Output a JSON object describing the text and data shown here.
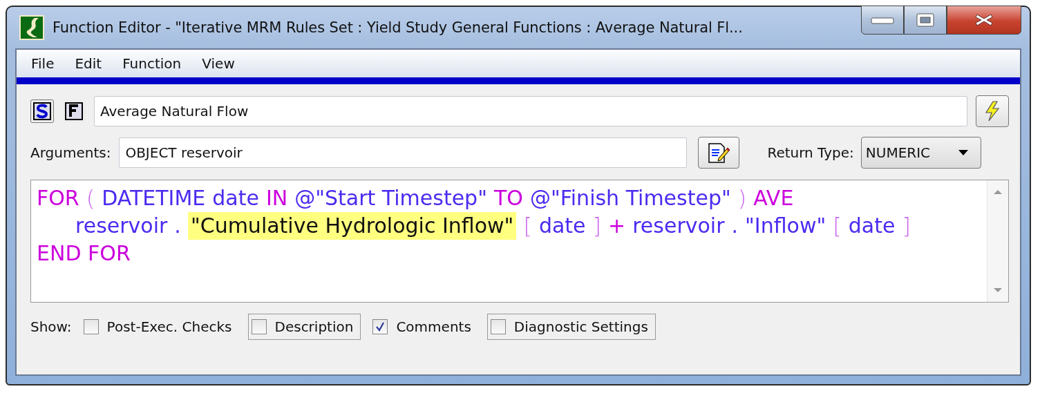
{
  "window": {
    "title": "Function Editor - \"Iterative MRM Rules Set : Yield Study General Functions : Average Natural Fl..."
  },
  "menu": [
    "File",
    "Edit",
    "Function",
    "View"
  ],
  "function_name": {
    "value": "Average Natural Flow"
  },
  "arguments": {
    "label": "Arguments:",
    "value": "OBJECT reservoir"
  },
  "return_type": {
    "label": "Return Type:",
    "value": "NUMERIC"
  },
  "code_lines": [
    {
      "indent": false,
      "tokens": [
        {
          "text": "FOR",
          "kind": "keyword"
        },
        {
          "text": "(",
          "kind": "bracket"
        },
        {
          "text": "DATETIME",
          "kind": "name"
        },
        {
          "text": "date",
          "kind": "name"
        },
        {
          "text": "IN",
          "kind": "keyword"
        },
        {
          "text": "@\"Start Timestep\"",
          "kind": "name"
        },
        {
          "text": "TO",
          "kind": "keyword"
        },
        {
          "text": "@\"Finish Timestep\"",
          "kind": "name"
        },
        {
          "text": ")",
          "kind": "bracket"
        },
        {
          "text": "AVE",
          "kind": "keyword"
        }
      ]
    },
    {
      "indent": true,
      "tokens": [
        {
          "text": "reservoir",
          "kind": "name"
        },
        {
          "text": ".",
          "kind": "name"
        },
        {
          "text": "\"Cumulative Hydrologic Inflow\"",
          "kind": "highlight"
        },
        {
          "text": "[",
          "kind": "bracket"
        },
        {
          "text": "date",
          "kind": "name"
        },
        {
          "text": "]",
          "kind": "bracket"
        },
        {
          "text": "+",
          "kind": "keyword"
        },
        {
          "text": "reservoir",
          "kind": "name"
        },
        {
          "text": ".",
          "kind": "name"
        },
        {
          "text": "\"Inflow\"",
          "kind": "name"
        },
        {
          "text": "[",
          "kind": "bracket"
        },
        {
          "text": "date",
          "kind": "name"
        },
        {
          "text": "]",
          "kind": "bracket"
        }
      ]
    },
    {
      "indent": false,
      "tokens": [
        {
          "text": "END FOR",
          "kind": "keyword"
        }
      ]
    }
  ],
  "show": {
    "label": "Show:",
    "options": [
      {
        "label": "Post-Exec. Checks",
        "checked": false,
        "framed": false
      },
      {
        "label": "Description",
        "checked": false,
        "framed": true
      },
      {
        "label": "Comments",
        "checked": true,
        "framed": false
      },
      {
        "label": "Diagnostic Settings",
        "checked": false,
        "framed": true
      }
    ]
  }
}
